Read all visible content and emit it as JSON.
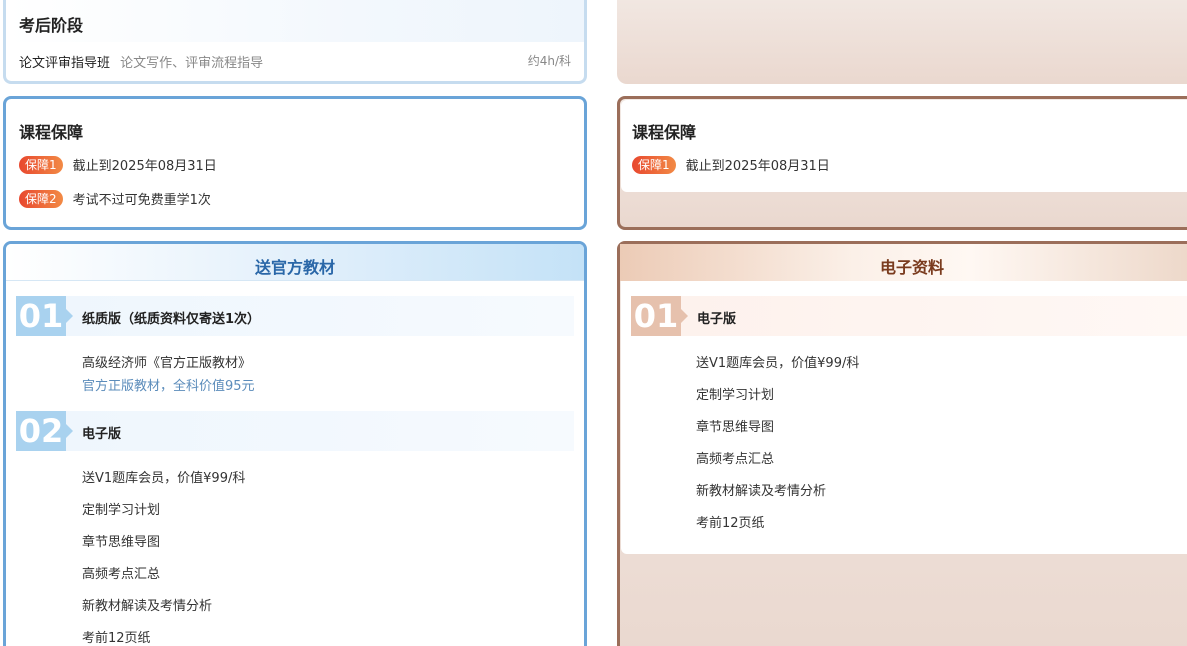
{
  "left": {
    "after_stage": {
      "title": "考后阶段",
      "course_name": "论文评审指导班",
      "course_desc": "论文写作、评审流程指导",
      "hours": "约4h/科"
    },
    "guarantee": {
      "title": "课程保障",
      "items": [
        {
          "badge": "保障1",
          "text": "截止到2025年08月31日"
        },
        {
          "badge": "保障2",
          "text": "考试不过可免费重学1次"
        }
      ]
    },
    "materials": {
      "header": "送官方教材",
      "sections": [
        {
          "num": "01",
          "title": "纸质版（纸质资料仅寄送1次）",
          "items": [
            "高级经济师《官方正版教材》"
          ],
          "note": "官方正版教材，全科价值95元"
        },
        {
          "num": "02",
          "title": "电子版",
          "items": [
            "送V1题库会员，价值¥99/科",
            "定制学习计划",
            "章节思维导图",
            "高频考点汇总",
            "新教材解读及考情分析",
            "考前12页纸"
          ]
        }
      ]
    }
  },
  "right": {
    "guarantee": {
      "title": "课程保障",
      "items": [
        {
          "badge": "保障1",
          "text": "截止到2025年08月31日"
        }
      ]
    },
    "materials": {
      "header": "电子资料",
      "sections": [
        {
          "num": "01",
          "title": "电子版",
          "items": [
            "送V1题库会员，价值¥99/科",
            "定制学习计划",
            "章节思维导图",
            "高频考点汇总",
            "新教材解读及考情分析",
            "考前12页纸"
          ]
        }
      ]
    }
  },
  "colors": {
    "blue_border": "#6aa4d8",
    "blue_title": "#2a67a8",
    "brown_border": "#9b6e5a",
    "brown_title": "#7a3b1e",
    "badge_start": "#e8482f",
    "badge_end": "#f28a45"
  }
}
